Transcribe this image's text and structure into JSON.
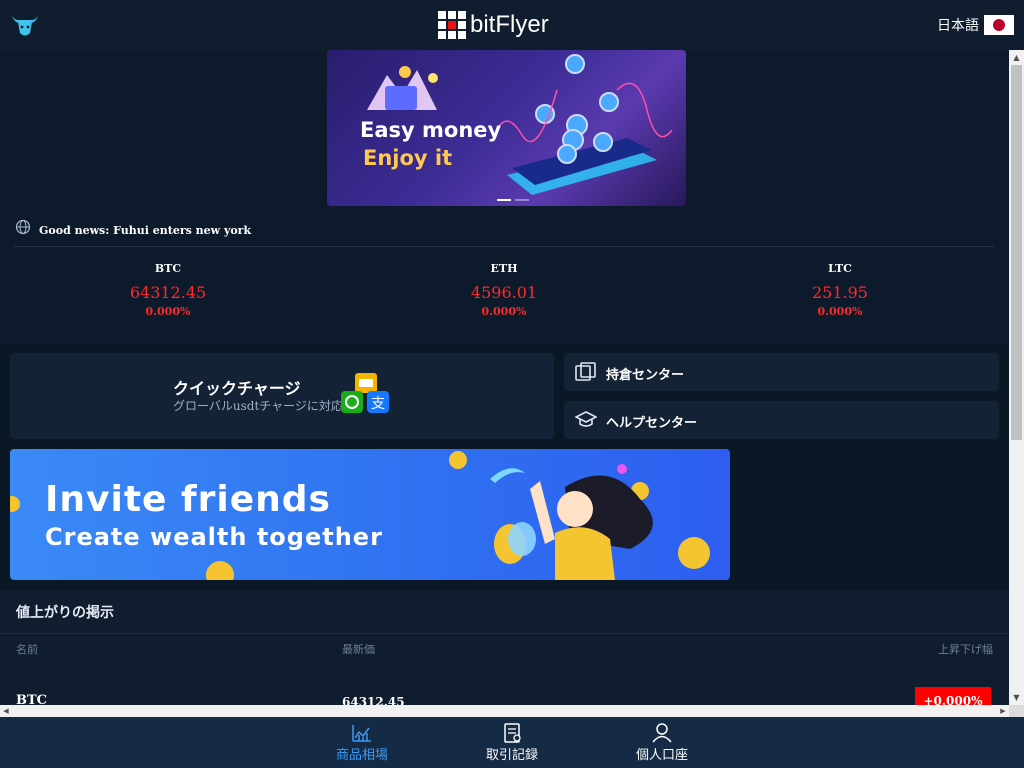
{
  "header": {
    "logo_text": "bitFlyer",
    "language": "日本語"
  },
  "banner": {
    "line1": "Easy money",
    "line2": "Enjoy it"
  },
  "news": {
    "text": "Good news: Fuhui enters new york"
  },
  "tickers": [
    {
      "symbol": "BTC",
      "price": "64312.45",
      "change": "0.000%"
    },
    {
      "symbol": "ETH",
      "price": "4596.01",
      "change": "0.000%"
    },
    {
      "symbol": "LTC",
      "price": "251.95",
      "change": "0.000%"
    }
  ],
  "quick_charge": {
    "title": "クイックチャージ",
    "subtitle": "グローバルusdtチャージに対応"
  },
  "side_buttons": [
    {
      "label": "持倉センター",
      "icon": "position-icon"
    },
    {
      "label": "ヘルプセンター",
      "icon": "graduation-cap-icon"
    }
  ],
  "invite": {
    "line1": "Invite friends",
    "line2": "Create wealth together"
  },
  "rising_list": {
    "title": "値上がりの掲示",
    "columns": [
      "名前",
      "最新価",
      "上昇下げ幅"
    ],
    "rows": [
      {
        "symbol": "BTC",
        "price": "64312.45",
        "change": "+0.000%"
      }
    ]
  },
  "bottom_nav": {
    "items": [
      {
        "label": "商品相場",
        "icon": "chart-icon",
        "active": true
      },
      {
        "label": "取引記録",
        "icon": "records-icon",
        "active": false
      },
      {
        "label": "個人口座",
        "icon": "user-icon",
        "active": false
      }
    ]
  },
  "colors": {
    "background": "#0c1a2b",
    "price_red": "#ff2a2a",
    "active_blue": "#3d9bf5"
  }
}
